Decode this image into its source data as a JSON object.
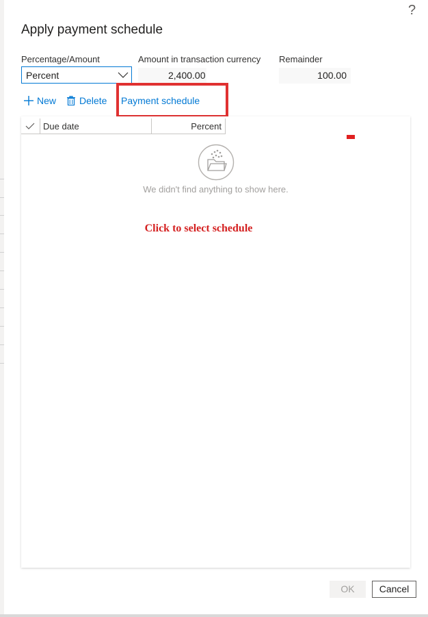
{
  "dialog": {
    "title": "Apply payment schedule",
    "help_glyph": "?"
  },
  "fields": {
    "percentage_amount": {
      "label": "Percentage/Amount",
      "value": "Percent"
    },
    "amount_transaction_currency": {
      "label": "Amount in transaction currency",
      "value": "2,400.00"
    },
    "remainder": {
      "label": "Remainder",
      "value": "100.00"
    }
  },
  "toolbar": {
    "new_label": "New",
    "delete_label": "Delete",
    "payment_schedule_label": "Payment schedule"
  },
  "grid": {
    "columns": [
      "Due date",
      "Percent"
    ],
    "empty_message": "We didn't find anything to show here."
  },
  "annotation": {
    "text": "Click to select schedule",
    "color": "#d42020"
  },
  "footer": {
    "ok_label": "OK",
    "cancel_label": "Cancel"
  },
  "colors": {
    "accent": "#0078d4",
    "highlight": "#e03131"
  }
}
